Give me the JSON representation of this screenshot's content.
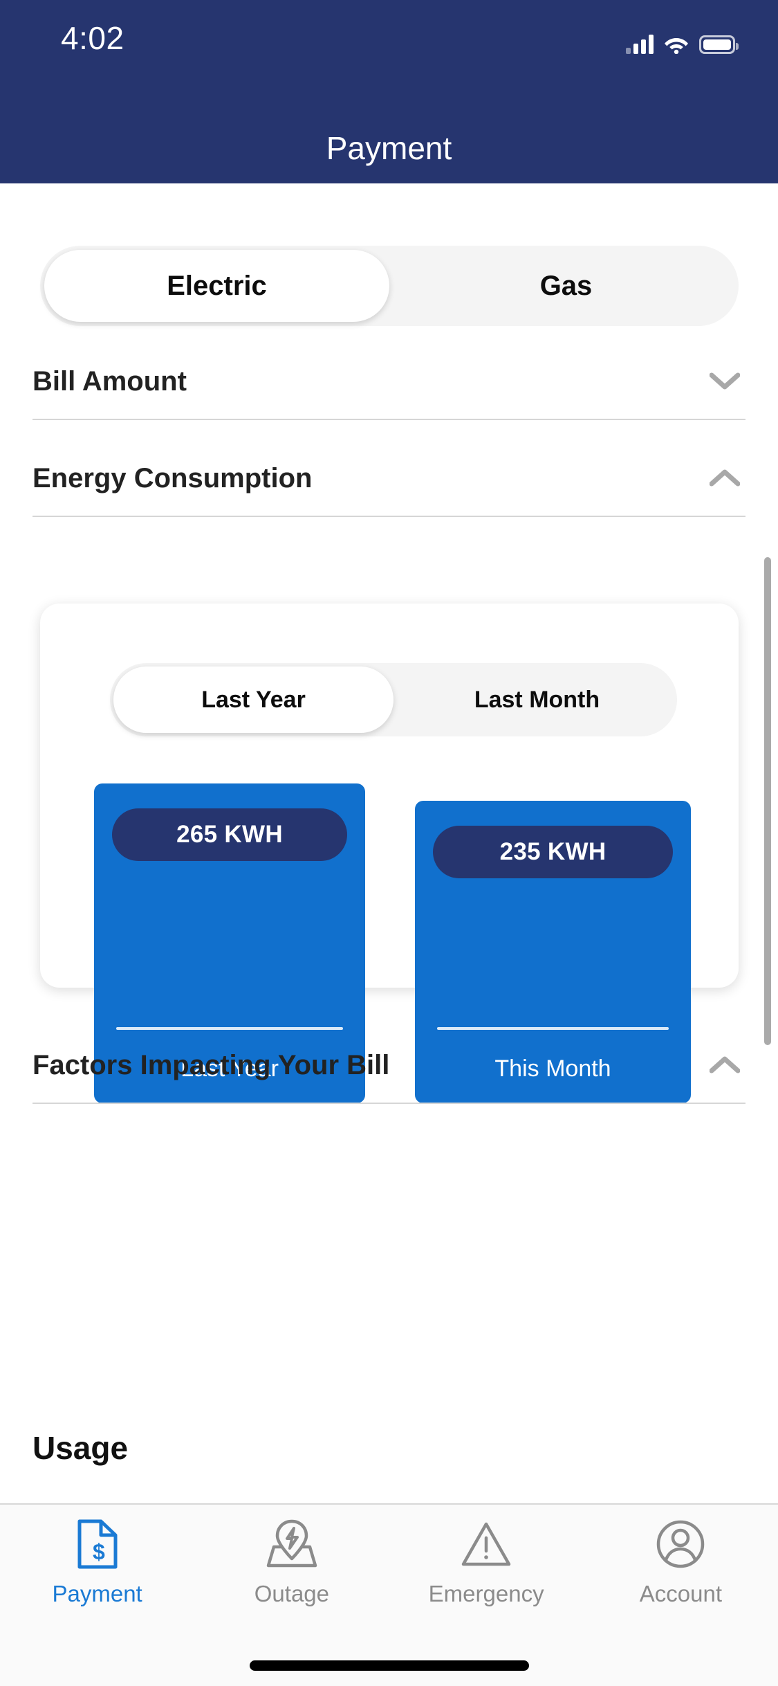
{
  "status_bar": {
    "time": "4:02",
    "icons": [
      "cellular-signal-icon",
      "wifi-icon",
      "battery-icon"
    ]
  },
  "header": {
    "title": "Payment"
  },
  "utility_toggle": {
    "options": [
      "Electric",
      "Gas"
    ],
    "selected": "Electric"
  },
  "sections": [
    {
      "title": "Bill Amount",
      "expanded": false,
      "chevron": "chevron-down-icon"
    },
    {
      "title": "Energy Consumption",
      "expanded": true,
      "chevron": "chevron-up-icon"
    },
    {
      "title": "Factors Impacting Your Bill",
      "expanded": true,
      "chevron": "chevron-up-icon"
    }
  ],
  "energy_card": {
    "period_toggle": {
      "options": [
        "Last Year",
        "Last Month"
      ],
      "selected": "Last Year"
    }
  },
  "usage_heading": "Usage",
  "tab_bar": {
    "items": [
      {
        "label": "Payment",
        "icon": "document-dollar-icon",
        "active": true
      },
      {
        "label": "Outage",
        "icon": "map-pin-bolt-icon",
        "active": false
      },
      {
        "label": "Emergency",
        "icon": "warning-triangle-icon",
        "active": false
      },
      {
        "label": "Account",
        "icon": "user-circle-icon",
        "active": false
      }
    ]
  },
  "colors": {
    "header_navy": "#26356f",
    "bar_blue": "#1170cd",
    "badge_navy": "#26356f",
    "accent_blue": "#1a7ad4",
    "inactive_gray": "#8b8b8b"
  },
  "chart_data": {
    "type": "bar",
    "title": "Energy Consumption",
    "categories": [
      "Last Year",
      "This Month"
    ],
    "values": [
      265,
      235
    ],
    "value_labels": [
      "265 KWH",
      "235 KWH"
    ],
    "unit": "KWH",
    "xlabel": "",
    "ylabel": "",
    "ylim": [
      0,
      300
    ],
    "grid": false,
    "legend": "none",
    "series": [
      {
        "name": "Energy Consumption",
        "values": [
          265,
          235
        ]
      }
    ]
  }
}
